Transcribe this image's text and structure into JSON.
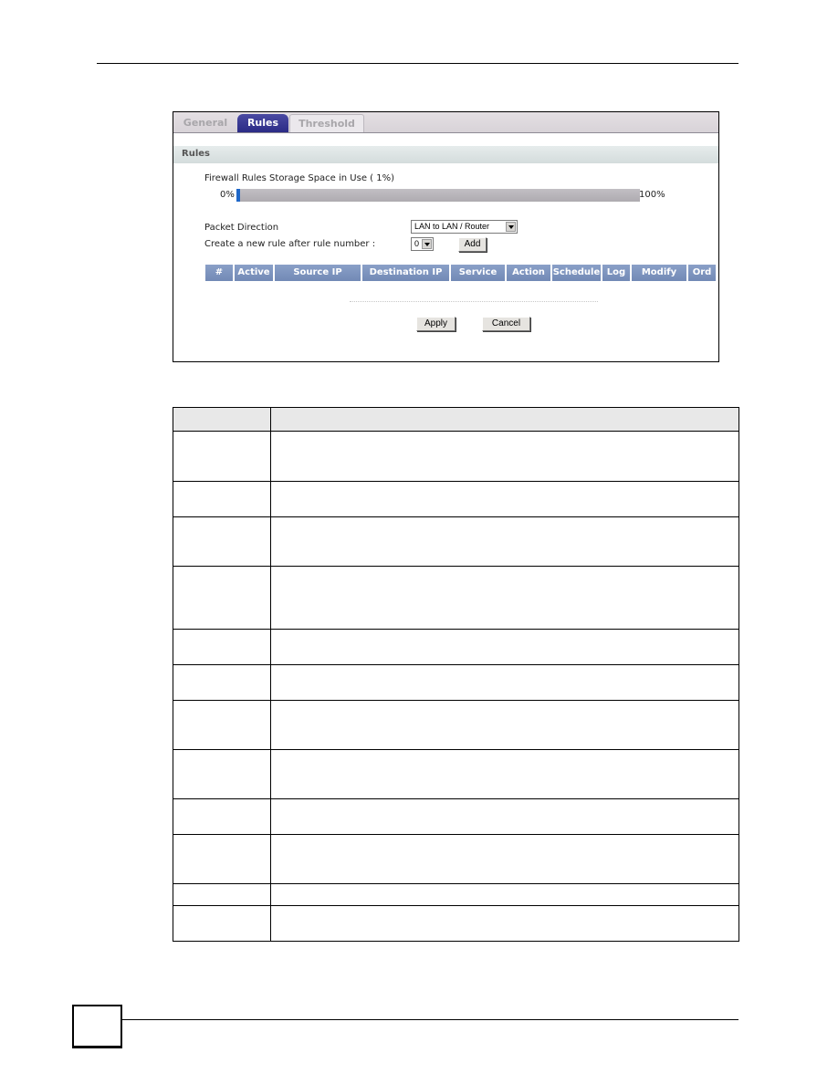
{
  "tabs": [
    {
      "label": "General",
      "active": false
    },
    {
      "label": "Rules",
      "active": true
    },
    {
      "label": "Threshold",
      "active": false
    }
  ],
  "section": {
    "title": "Rules"
  },
  "storage": {
    "label": "Firewall Rules Storage Space in Use  ( 1%)",
    "min_label": "0%",
    "max_label": "100%",
    "percent_in_use": 1
  },
  "packet_direction": {
    "label": "Packet Direction",
    "value": "LAN to LAN / Router"
  },
  "new_rule": {
    "label": "Create a new rule after rule number :",
    "value": "0",
    "add_label": "Add"
  },
  "rules_table": {
    "columns": [
      "#",
      "Active",
      "Source IP",
      "Destination IP",
      "Service",
      "Action",
      "Schedule",
      "Log",
      "Modify",
      "Ord"
    ]
  },
  "buttons": {
    "apply": "Apply",
    "cancel": "Cancel"
  },
  "description_table": {
    "row_count": 12
  }
}
